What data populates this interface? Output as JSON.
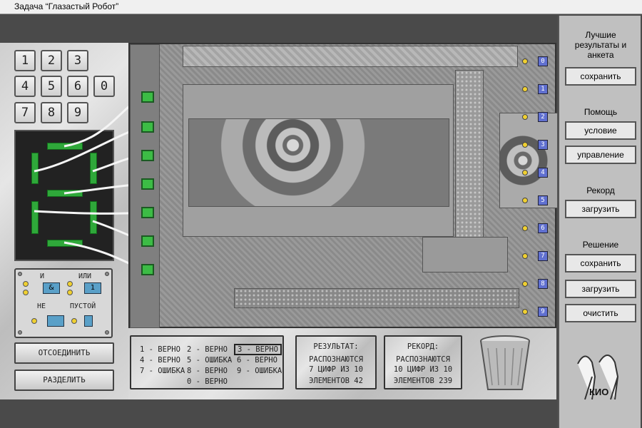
{
  "window": {
    "title": "Задача “Глазастый Робот”"
  },
  "keypad": [
    "1",
    "2",
    "3",
    "4",
    "5",
    "6",
    "0",
    "7",
    "8",
    "9"
  ],
  "gates": {
    "and_label": "И",
    "or_label": "ИЛИ",
    "not_label": "НЕ",
    "empty_label": "ПУСТОЙ",
    "and_symbol": "&",
    "or_symbol": "1"
  },
  "actions": {
    "disconnect": "ОТСОЕДИНИТЬ",
    "split": "РАЗДЕЛИТЬ"
  },
  "outputs": [
    "0",
    "1",
    "2",
    "3",
    "4",
    "5",
    "6",
    "7",
    "8",
    "9"
  ],
  "digit_results": [
    [
      "1 - ВЕРНО",
      "2 - ВЕРНО",
      "3 - ВЕРНО"
    ],
    [
      "4 - ВЕРНО",
      "5 - ОШИБКА",
      "6 - ВЕРНО"
    ],
    [
      "7 - ОШИБКА",
      "8 - ВЕРНО",
      "9 - ОШИБКА"
    ],
    [
      "",
      "0 - ВЕРНО",
      ""
    ]
  ],
  "result": {
    "title": "РЕЗУЛЬТАТ:",
    "line1": "РАСПОЗНАЮТСЯ",
    "line2": "7 ЦИФР ИЗ 10",
    "line3": "ЭЛЕМЕНТОВ 42"
  },
  "record": {
    "title": "РЕКОРД:",
    "line1": "РАСПОЗНАЮТСЯ",
    "line2": "10 ЦИФР ИЗ 10",
    "line3": "ЭЛЕМЕНТОВ 239"
  },
  "sidebar": {
    "best_label": "Лучшие результаты и анкета",
    "best_save": "сохранить",
    "help_label": "Помощь",
    "help_condition": "условие",
    "help_controls": "управление",
    "record_label": "Рекорд",
    "record_load": "загрузить",
    "solution_label": "Решение",
    "solution_save": "сохранить",
    "solution_load": "загрузить",
    "solution_clear": "очистить",
    "logo_text": "КИО"
  }
}
